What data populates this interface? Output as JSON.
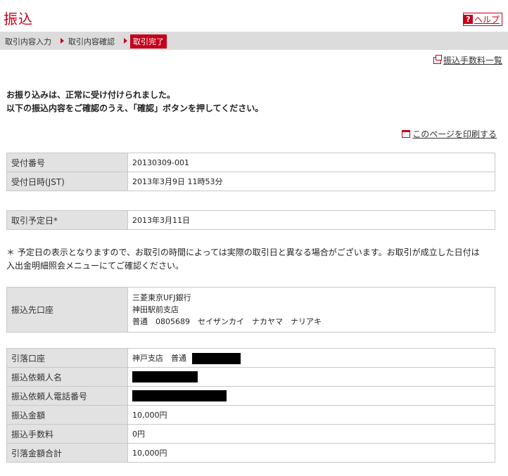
{
  "page": {
    "title": "振込",
    "help_label": "ヘルプ"
  },
  "steps": [
    {
      "label": "取引内容入力"
    },
    {
      "label": "取引内容確認"
    },
    {
      "label": "取引完了"
    }
  ],
  "links": {
    "fee_list": "振込手数料一覧",
    "print": "このページを印刷する"
  },
  "message": {
    "line1": "お振り込みは、正常に受け付けられました。",
    "line2": "以下の振込内容をご確認のうえ、「確認」ボタンを押してください。"
  },
  "receipt": {
    "number_label": "受付番号",
    "number_value": "20130309-001",
    "datetime_label": "受付日時(JST)",
    "datetime_value": "2013年3月9日 11時53分"
  },
  "scheduled": {
    "label": "取引予定日*",
    "value": "2013年3月11日"
  },
  "note": {
    "line1": "＊ 予定日の表示となりますので、お取引の時間によっては実際の取引日と異なる場合がございます。お取引が成立した日付は",
    "line2": "入出金明細照会メニューにてご確認ください。"
  },
  "payee": {
    "label": "振込先口座",
    "bank": "三菱東京UFJ銀行",
    "branch": "神田駅前支店",
    "account": "普通　0805689　セイザンカイ　ナカヤマ　ナリアキ"
  },
  "details": [
    {
      "label": "引落口座",
      "value": "神戸支店　普通",
      "redacted": true
    },
    {
      "label": "振込依頼人名",
      "value": "",
      "redacted": true
    },
    {
      "label": "振込依頼人電話番号",
      "value": "",
      "redacted": true
    },
    {
      "label": "振込金額",
      "value": "10,000円"
    },
    {
      "label": "振込手数料",
      "value": "0円"
    },
    {
      "label": "引落金額合計",
      "value": "10,000円"
    }
  ],
  "colors": {
    "accent": "#c4001a",
    "label_bg": "#e2e2e2",
    "step_bar": "#dcdcdc"
  }
}
